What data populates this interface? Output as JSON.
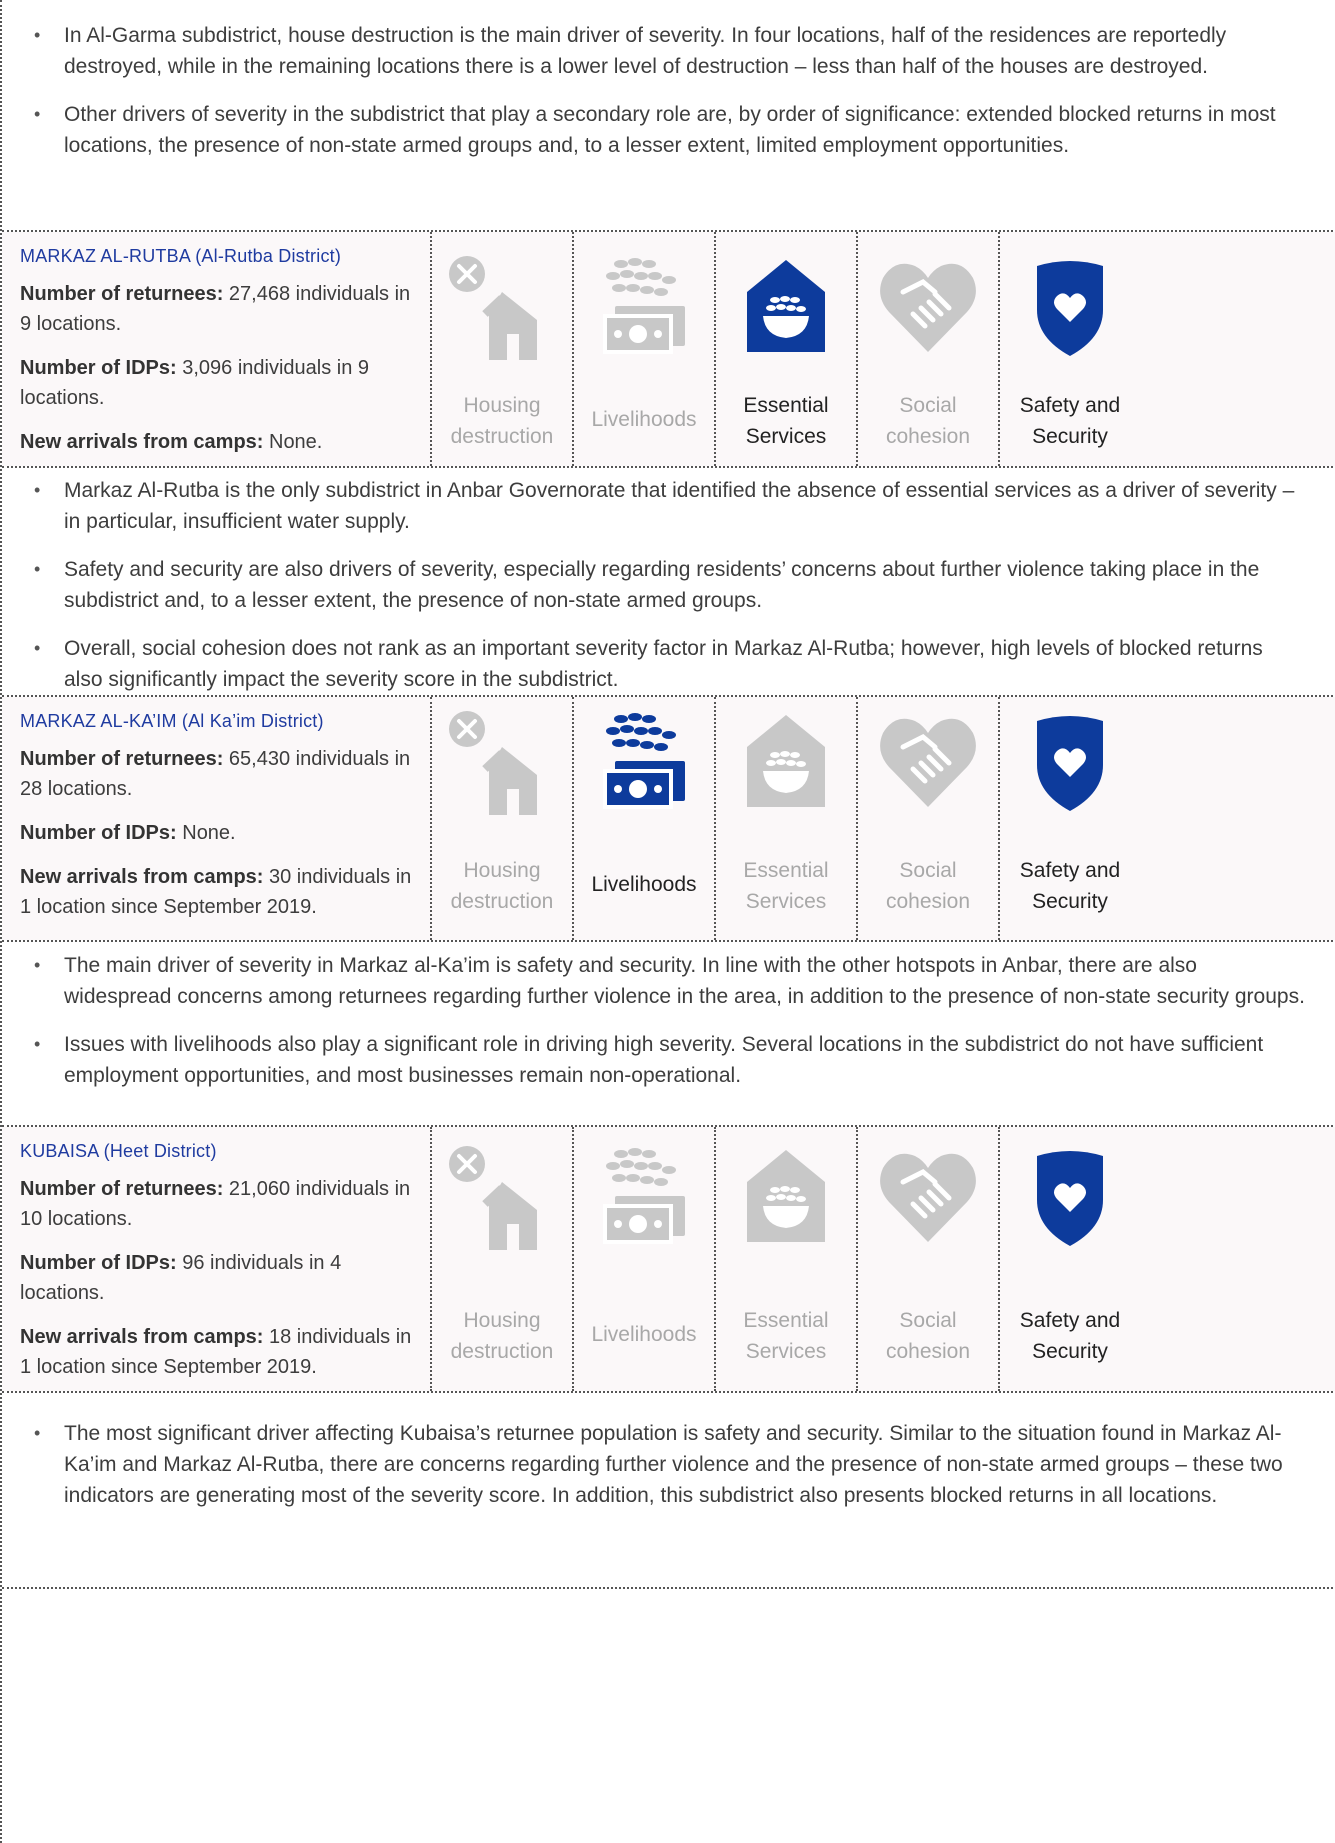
{
  "top_bullets": [
    "In Al-Garma subdistrict, house destruction is the main driver of severity. In four locations, half of the residences are reportedly destroyed, while in the remaining locations there is a lower level of destruction – less than half of the houses are destroyed.",
    "Other drivers of severity in the subdistrict that play a secondary role are, by order of significance: extended blocked returns in most locations, the presence of non-state armed groups and, to a lesser extent, limited employment opportunities."
  ],
  "categories": [
    "Housing destruction",
    "Livelihoods",
    "Essential Services",
    "Social cohesion",
    "Safety and Security"
  ],
  "category_labels": {
    "housing": [
      "Housing",
      "destruction"
    ],
    "livelihoods": [
      "Livelihoods"
    ],
    "essential": [
      "Essential",
      "Services"
    ],
    "social": [
      "Social",
      "cohesion"
    ],
    "safety": [
      "Safety and",
      "Security"
    ]
  },
  "icons": [
    "house-destroyed-icon",
    "livelihoods-icon",
    "essential-services-icon",
    "handshake-heart-icon",
    "shield-heart-icon"
  ],
  "colors": {
    "active": "#0d3b9c",
    "inactive": "#c8c8c8",
    "title": "#1f3ba0"
  },
  "sections": [
    {
      "title": "MARKAZ AL-RUTBA (Al-Rutba District)",
      "returnees_label": "Number of returnees:",
      "returnees_value": " 27,468 individuals in 9 locations.",
      "idps_label": "Number of IDPs:",
      "idps_value": " 3,096 individuals in 9 locations.",
      "arrivals_label": "New arrivals from camps:",
      "arrivals_value": " None.",
      "active": [
        false,
        false,
        true,
        false,
        true
      ],
      "bullets": [
        "Markaz Al-Rutba is the only subdistrict in Anbar Governorate that identified the absence of essential services as a driver of severity – in particular, insufficient water supply.",
        "Safety and security are also drivers of severity, especially regarding residents’ concerns about further violence taking place in the subdistrict and, to a lesser extent, the presence of non-state armed groups.",
        "Overall, social cohesion does not rank as an important severity factor in Markaz Al-Rutba; however, high levels of blocked returns also significantly impact the severity score in the subdistrict."
      ]
    },
    {
      "title": "MARKAZ AL-KA’IM (Al Ka’im District)",
      "returnees_label": "Number of returnees:",
      "returnees_value": " 65,430 individuals in 28 locations.",
      "idps_label": "Number of IDPs:",
      "idps_value": " None.",
      "arrivals_label": "New arrivals from camps:",
      "arrivals_value": " 30 individuals in 1 location since September 2019.",
      "active": [
        false,
        true,
        false,
        false,
        true
      ],
      "bullets": [
        "The main driver of severity in Markaz al-Ka’im is safety and security. In line with the other hotspots in Anbar, there are also widespread concerns among returnees regarding further violence in the area, in addition to the presence of non-state security groups.",
        "Issues with livelihoods also play a significant role in driving high severity. Several locations in the subdistrict do not have sufficient employment opportunities, and most businesses remain non-operational."
      ]
    },
    {
      "title": "KUBAISA (Heet District)",
      "returnees_label": "Number of returnees:",
      "returnees_value": " 21,060 individuals in 10 locations.",
      "idps_label": "Number of IDPs:",
      "idps_value": " 96 individuals in 4 locations.",
      "arrivals_label": "New arrivals from camps:",
      "arrivals_value": " 18 individuals in 1 location since September 2019.",
      "active": [
        false,
        false,
        false,
        false,
        true
      ],
      "bullets": [
        "The most significant driver affecting Kubaisa’s returnee population is safety and security. Similar to the situation found in Markaz Al-Ka’im and Markaz Al-Rutba, there are concerns regarding further violence and the presence of non-state armed groups – these two indicators are generating most of the severity score. In addition, this subdistrict also presents blocked returns in all locations."
      ]
    }
  ]
}
